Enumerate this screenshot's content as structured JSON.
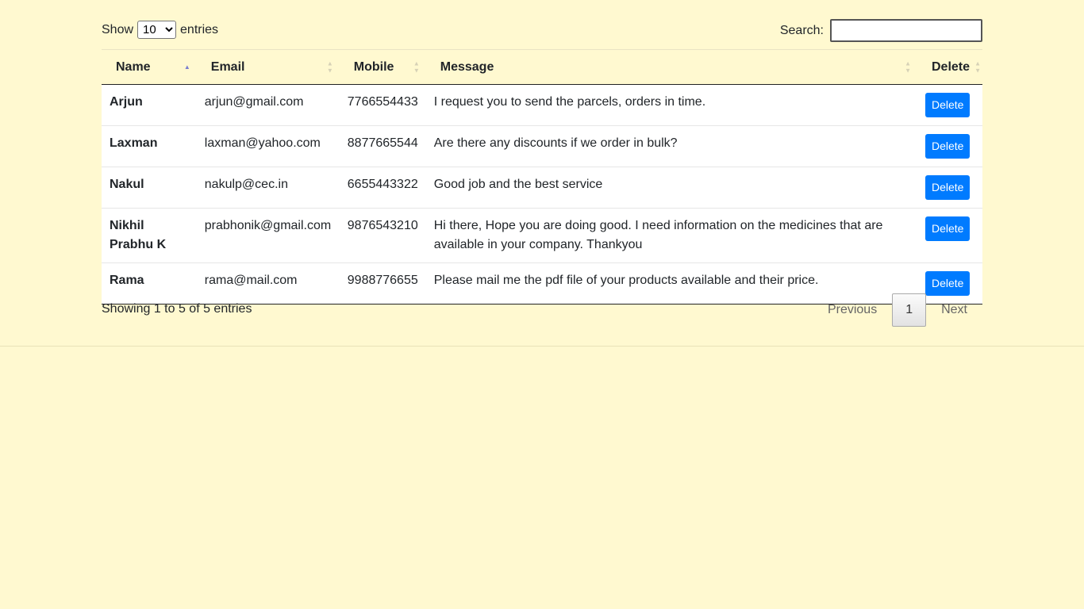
{
  "length": {
    "show_label": "Show",
    "entries_label": "entries",
    "selected": "10"
  },
  "search": {
    "label": "Search:",
    "value": ""
  },
  "table": {
    "headers": [
      "Name",
      "Email",
      "Mobile",
      "Message",
      "Delete"
    ],
    "rows": [
      {
        "name": "Arjun",
        "email": "arjun@gmail.com",
        "mobile": "7766554433",
        "message": "I request you to send the parcels, orders in time.",
        "action": "Delete"
      },
      {
        "name": "Laxman",
        "email": "laxman@yahoo.com",
        "mobile": "8877665544",
        "message": "Are there any discounts if we order in bulk?",
        "action": "Delete"
      },
      {
        "name": "Nakul",
        "email": "nakulp@cec.in",
        "mobile": "6655443322",
        "message": "Good job and the best service",
        "action": "Delete"
      },
      {
        "name": "Nikhil Prabhu K",
        "email": "prabhonik@gmail.com",
        "mobile": "9876543210",
        "message": "Hi there, Hope you are doing good. I need information on the medicines that are available in your company. Thankyou",
        "action": "Delete"
      },
      {
        "name": "Rama",
        "email": "rama@mail.com",
        "mobile": "9988776655",
        "message": "Please mail me the pdf file of your products available and their price.",
        "action": "Delete"
      }
    ]
  },
  "footer": {
    "info": "Showing 1 to 5 of 5 entries",
    "previous": "Previous",
    "current_page": "1",
    "next": "Next"
  },
  "colors": {
    "background": "#fff9d0",
    "button": "#007bff"
  }
}
